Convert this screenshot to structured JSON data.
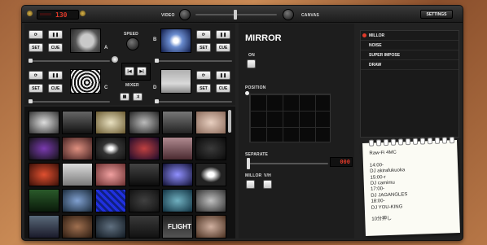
{
  "topbar": {
    "bpm_value": "130",
    "video_label": "VIDEO",
    "canvas_label": "CANVAS",
    "settings_label": "SETTINGS"
  },
  "deck": {
    "a_label": "A",
    "b_label": "B",
    "c_label": "C",
    "d_label": "D",
    "set_label": "SET",
    "cue_label": "CUE",
    "speed_label": "SPEED",
    "mixer_label": "MIXER"
  },
  "library": {
    "thumbnail_text": "FLIGHT"
  },
  "effect": {
    "title": "MIRROR",
    "on_label": "ON",
    "position_label": "POSITION",
    "separate_label": "SEPARATE",
    "separate_value": "000",
    "millor_label": "MILLOR",
    "vh_label": "V/H",
    "list": [
      "MILLOR",
      "NOISE",
      "SUPER IMPOSE",
      "DRAW"
    ],
    "selected_index": 0
  },
  "note": {
    "lines": [
      "Raw-Fi 4MC",
      "",
      "14:00-",
      "DJ akirafukuoka",
      "15:00-r",
      "DJ camimu",
      "17:00-",
      "DJ JAGANGLES",
      "18:00-",
      "DJ YOU-KING",
      "",
      "10分押し"
    ]
  },
  "colors": {
    "accent_red": "#e03a2a",
    "panel": "#1d1d1d",
    "frame": "#222222"
  }
}
